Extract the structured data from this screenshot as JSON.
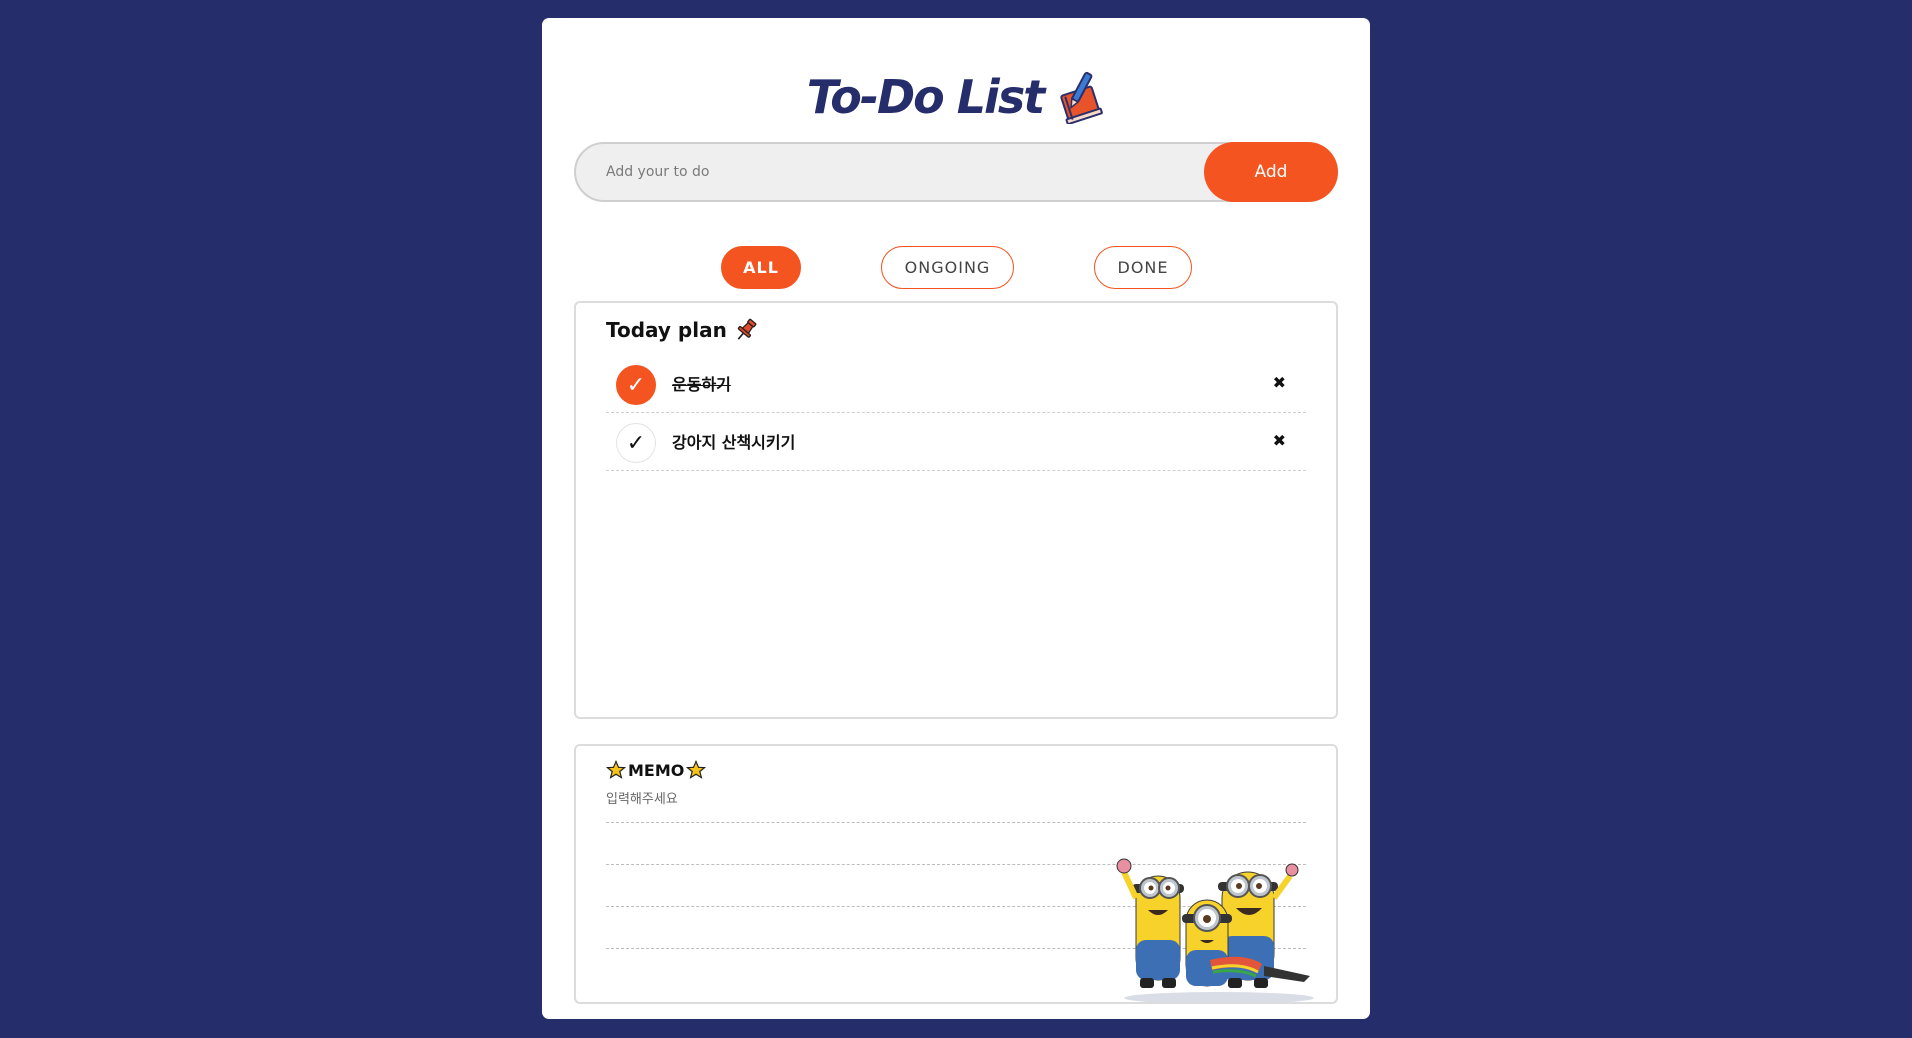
{
  "header": {
    "title": "To-Do List",
    "title_icon": "notebook-pen-icon"
  },
  "add_form": {
    "placeholder": "Add your to do",
    "add_label": "Add"
  },
  "filters": [
    {
      "label": "ALL",
      "active": true
    },
    {
      "label": "ONGOING",
      "active": false
    },
    {
      "label": "DONE",
      "active": false
    }
  ],
  "plan": {
    "title": "Today plan",
    "title_icon": "pushpin-icon",
    "items": [
      {
        "text": "운동하기",
        "done": true,
        "check_glyph": "✓",
        "delete_glyph": "✖"
      },
      {
        "text": "강아지 산책시키기",
        "done": false,
        "check_glyph": "✓",
        "delete_glyph": "✖"
      }
    ]
  },
  "memo": {
    "title": "MEMO",
    "title_icon": "star-icon",
    "placeholder": "입력해주세요",
    "illustration": "minions-illustration"
  },
  "colors": {
    "background": "#262d6b",
    "accent": "#f4541f",
    "title": "#262d6b"
  }
}
